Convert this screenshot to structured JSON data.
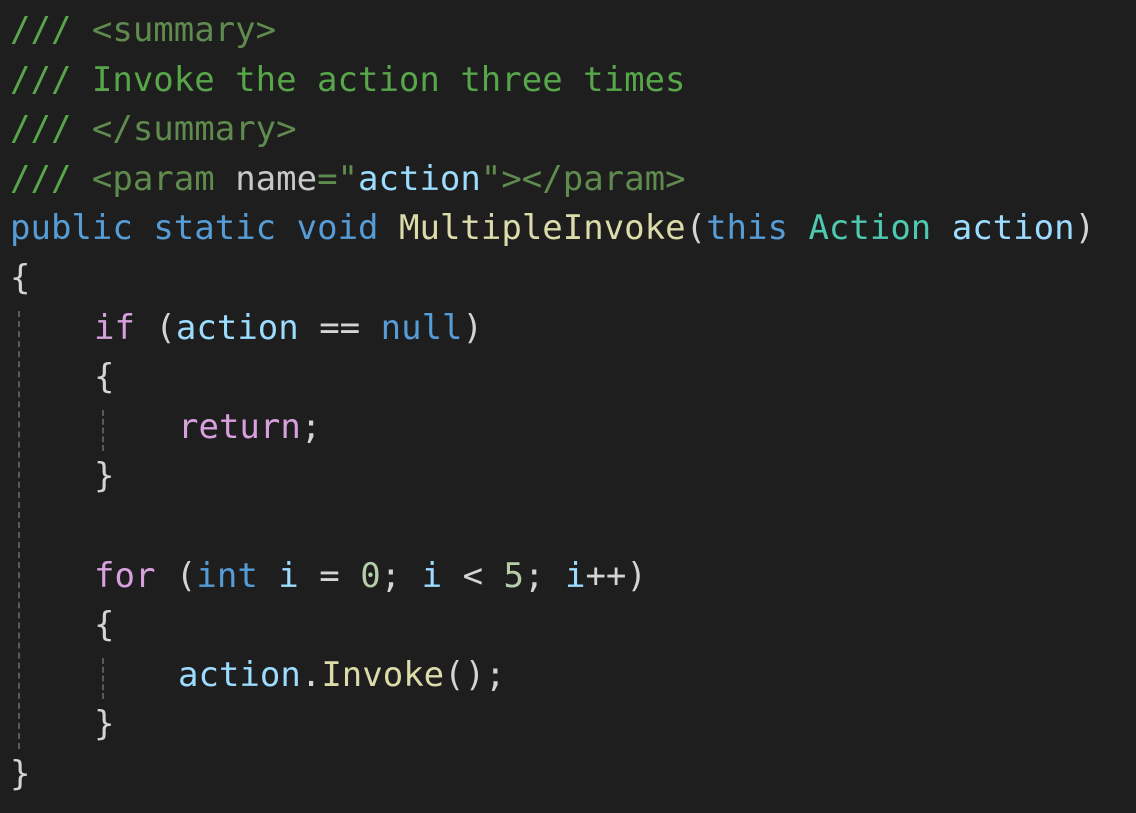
{
  "editor": {
    "colors": {
      "background": "#1e1e1e",
      "comment": "#57a64a",
      "xmldoc_tag": "#608b4e",
      "xmldoc_attr": "#c8c8c8",
      "string": "#9cdcfe",
      "keyword": "#569cd6",
      "control": "#d8a0df",
      "method": "#dcdcaa",
      "type": "#4ec9b0",
      "identifier": "#9cdcfe",
      "number": "#b5cea8",
      "plain": "#d4d4d4"
    },
    "lines": [
      {
        "indent": 0,
        "tokens": [
          {
            "t": "/// ",
            "c": "comment"
          },
          {
            "t": "<summary>",
            "c": "xmldoc_tag"
          }
        ]
      },
      {
        "indent": 0,
        "tokens": [
          {
            "t": "/// Invoke the action three times",
            "c": "comment"
          }
        ]
      },
      {
        "indent": 0,
        "tokens": [
          {
            "t": "/// ",
            "c": "comment"
          },
          {
            "t": "</summary>",
            "c": "xmldoc_tag"
          }
        ]
      },
      {
        "indent": 0,
        "tokens": [
          {
            "t": "/// ",
            "c": "comment"
          },
          {
            "t": "<param ",
            "c": "xmldoc_tag"
          },
          {
            "t": "name",
            "c": "xmldoc_attr"
          },
          {
            "t": "=\"",
            "c": "xmldoc_tag"
          },
          {
            "t": "action",
            "c": "string"
          },
          {
            "t": "\"></param>",
            "c": "xmldoc_tag"
          }
        ]
      },
      {
        "indent": 0,
        "tokens": [
          {
            "t": "public",
            "c": "keyword"
          },
          {
            "t": " ",
            "c": "plain"
          },
          {
            "t": "static",
            "c": "keyword"
          },
          {
            "t": " ",
            "c": "plain"
          },
          {
            "t": "void",
            "c": "keyword"
          },
          {
            "t": " ",
            "c": "plain"
          },
          {
            "t": "MultipleInvoke",
            "c": "method"
          },
          {
            "t": "(",
            "c": "plain"
          },
          {
            "t": "this",
            "c": "keyword"
          },
          {
            "t": " ",
            "c": "plain"
          },
          {
            "t": "Action",
            "c": "type"
          },
          {
            "t": " ",
            "c": "plain"
          },
          {
            "t": "action",
            "c": "identifier"
          },
          {
            "t": ")",
            "c": "plain"
          }
        ]
      },
      {
        "indent": 0,
        "tokens": [
          {
            "t": "{",
            "c": "plain"
          }
        ]
      },
      {
        "indent": 1,
        "tokens": [
          {
            "t": "if",
            "c": "control"
          },
          {
            "t": " (",
            "c": "plain"
          },
          {
            "t": "action",
            "c": "identifier"
          },
          {
            "t": " == ",
            "c": "plain"
          },
          {
            "t": "null",
            "c": "keyword"
          },
          {
            "t": ")",
            "c": "plain"
          }
        ]
      },
      {
        "indent": 1,
        "tokens": [
          {
            "t": "{",
            "c": "plain"
          }
        ]
      },
      {
        "indent": 2,
        "tokens": [
          {
            "t": "return",
            "c": "control"
          },
          {
            "t": ";",
            "c": "plain"
          }
        ]
      },
      {
        "indent": 1,
        "tokens": [
          {
            "t": "}",
            "c": "plain"
          }
        ]
      },
      {
        "indent": 0,
        "tokens": []
      },
      {
        "indent": 1,
        "tokens": [
          {
            "t": "for",
            "c": "control"
          },
          {
            "t": " (",
            "c": "plain"
          },
          {
            "t": "int",
            "c": "keyword"
          },
          {
            "t": " ",
            "c": "plain"
          },
          {
            "t": "i",
            "c": "identifier"
          },
          {
            "t": " = ",
            "c": "plain"
          },
          {
            "t": "0",
            "c": "number"
          },
          {
            "t": "; ",
            "c": "plain"
          },
          {
            "t": "i",
            "c": "identifier"
          },
          {
            "t": " < ",
            "c": "plain"
          },
          {
            "t": "5",
            "c": "number"
          },
          {
            "t": "; ",
            "c": "plain"
          },
          {
            "t": "i",
            "c": "identifier"
          },
          {
            "t": "++)",
            "c": "plain"
          }
        ]
      },
      {
        "indent": 1,
        "tokens": [
          {
            "t": "{",
            "c": "plain"
          }
        ]
      },
      {
        "indent": 2,
        "tokens": [
          {
            "t": "action",
            "c": "identifier"
          },
          {
            "t": ".",
            "c": "plain"
          },
          {
            "t": "Invoke",
            "c": "method"
          },
          {
            "t": "();",
            "c": "plain"
          }
        ]
      },
      {
        "indent": 1,
        "tokens": [
          {
            "t": "}",
            "c": "plain"
          }
        ]
      },
      {
        "indent": 0,
        "tokens": [
          {
            "t": "}",
            "c": "plain"
          }
        ]
      }
    ]
  }
}
